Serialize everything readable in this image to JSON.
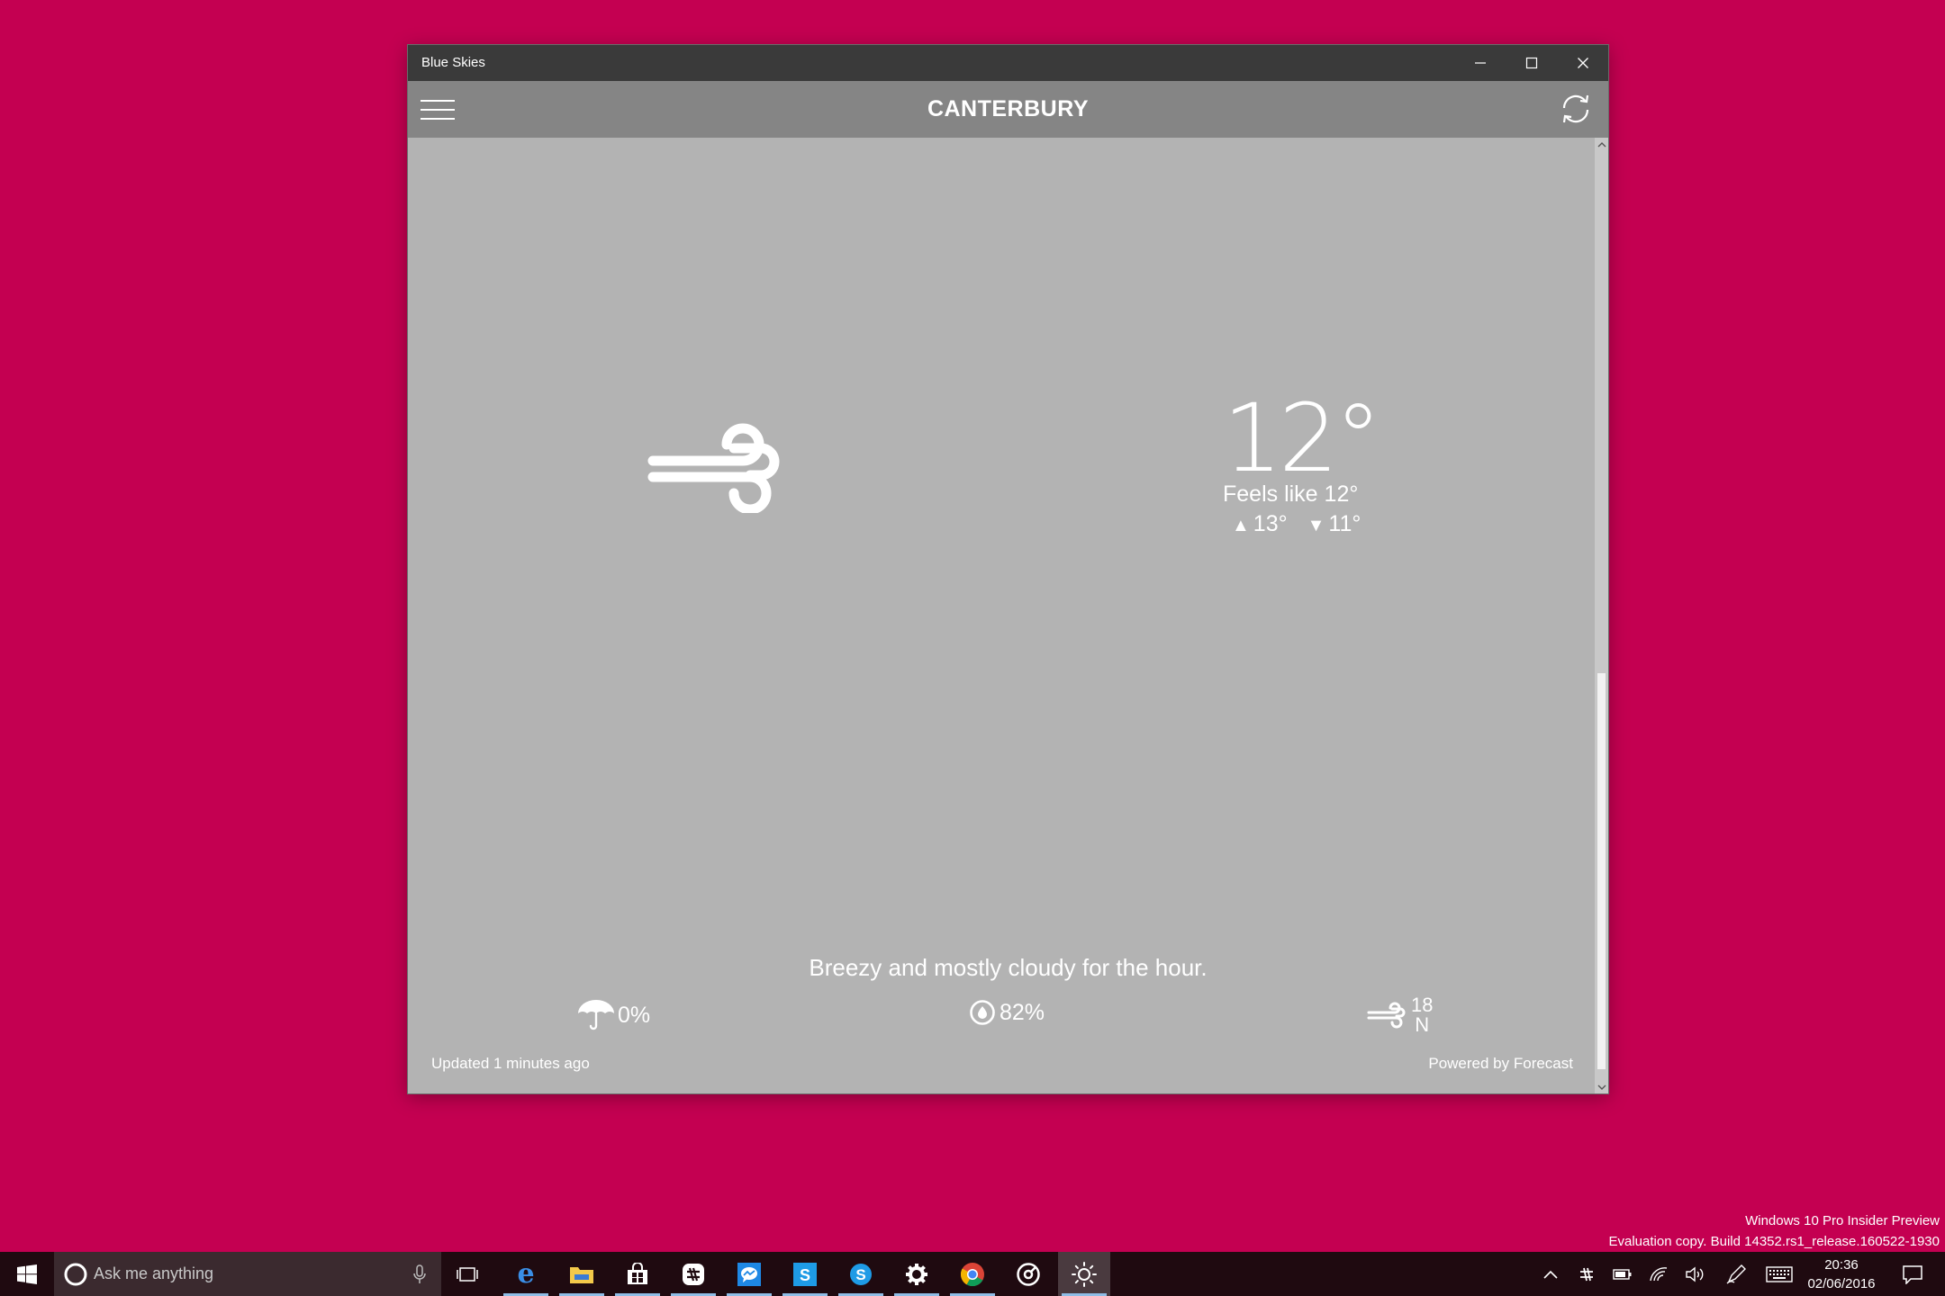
{
  "window": {
    "title": "Blue Skies",
    "city": "CANTERBURY"
  },
  "weather": {
    "current_icon": "wind-icon",
    "temperature": "12°",
    "feels_like_label": "Feels like",
    "feels_like_value": "12°",
    "high": "13°",
    "low": "11°",
    "summary": "Breezy and mostly cloudy for the hour.",
    "precipitation": "0%",
    "humidity": "82%",
    "wind_speed": "18",
    "wind_direction": "N",
    "updated": "Updated 1 minutes ago",
    "powered_by": "Powered by Forecast"
  },
  "watermark": {
    "line1": "Windows 10 Pro Insider Preview",
    "line2": "Evaluation copy. Build 14352.rs1_release.160522-1930"
  },
  "taskbar": {
    "search_placeholder": "Ask me anything",
    "apps": [
      "edge-icon",
      "file-explorer-icon",
      "store-icon",
      "slack-icon",
      "messenger-icon",
      "skype-icon",
      "skype-alt-icon",
      "settings-icon",
      "chrome-icon",
      "groove-icon",
      "blue-skies-icon"
    ],
    "time": "20:36",
    "date": "02/06/2016"
  },
  "colors": {
    "desktop": "#c40051",
    "window_bg": "#b3b3b3",
    "appbar": "#858585",
    "titlebar": "#3a3a3a",
    "taskbar": "#1f0a10"
  }
}
